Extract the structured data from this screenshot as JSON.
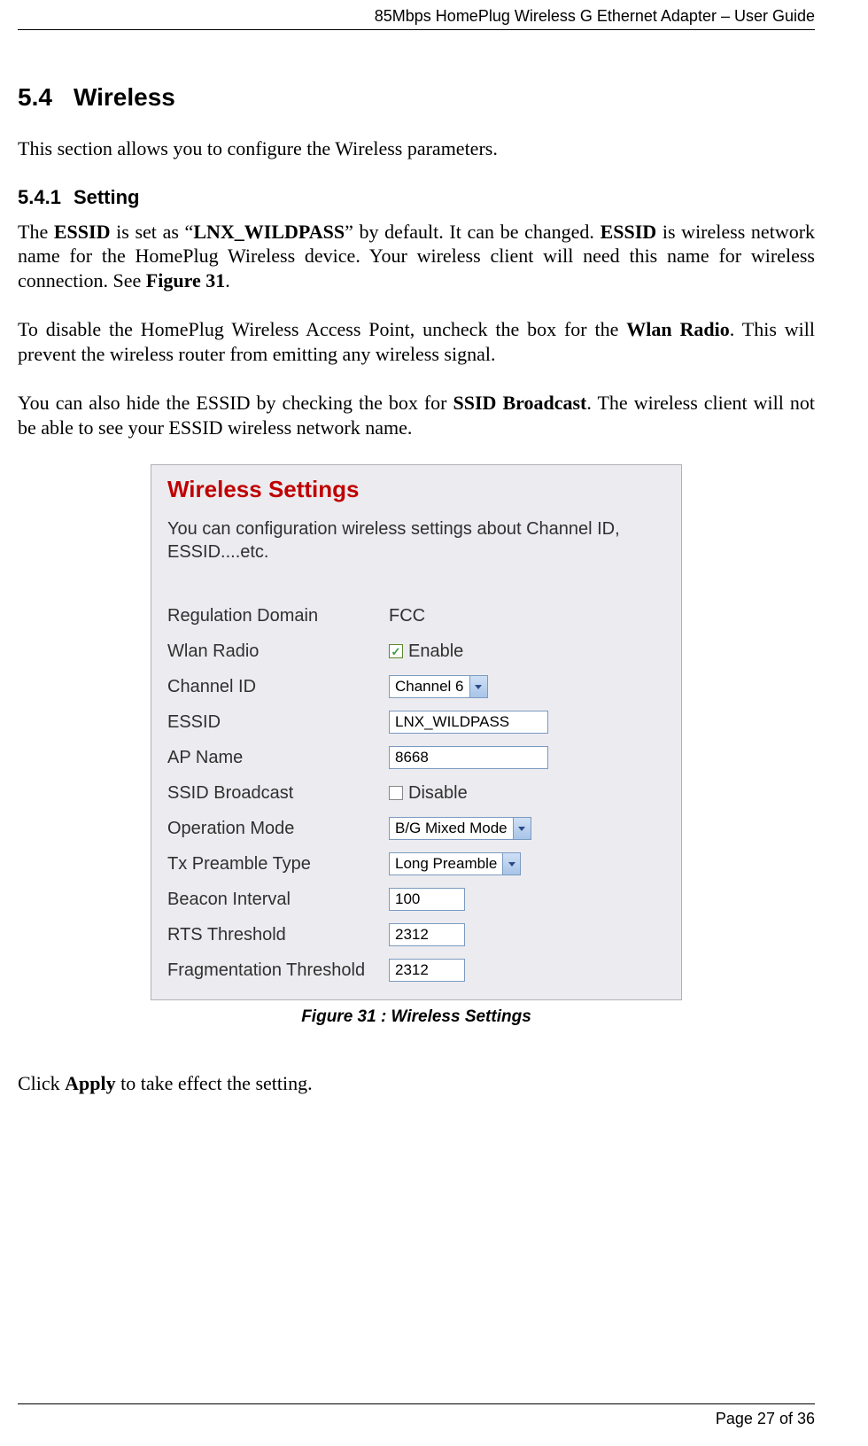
{
  "header": {
    "title": "85Mbps HomePlug Wireless G Ethernet Adapter – User Guide"
  },
  "section": {
    "number": "5.4",
    "title": "Wireless",
    "intro": "This section allows you to configure the Wireless parameters.",
    "sub": {
      "number": "5.4.1",
      "title": "Setting"
    },
    "p1_a": "The ",
    "p1_b": "ESSID",
    "p1_c": " is set as “",
    "p1_d": "LNX_WILDPASS",
    "p1_e": "” by default. It can be changed. ",
    "p1_f": "ESSID",
    "p1_g": " is wireless network name for the HomePlug Wireless device. Your wireless client will need this name for wireless connection. See ",
    "p1_h": "Figure 31",
    "p1_i": ".",
    "p2_a": "To disable the HomePlug Wireless Access Point, uncheck the box for the ",
    "p2_b": "Wlan Radio",
    "p2_c": ". This will prevent the wireless router from emitting any wireless signal.",
    "p3_a": "You can also hide the ESSID by checking the box for ",
    "p3_b": "SSID Broadcast",
    "p3_c": ". The wireless client will not be able to see your ESSID wireless network name.",
    "caption": "Figure 31 : Wireless Settings",
    "apply_a": "Click ",
    "apply_b": "Apply",
    "apply_c": " to take effect the setting."
  },
  "panel": {
    "title": "Wireless Settings",
    "desc": "You can configuration wireless settings about Channel ID, ESSID....etc.",
    "rows": {
      "reg_label": "Regulation Domain",
      "reg_value": "FCC",
      "wlan_label": "Wlan Radio",
      "wlan_text": "Enable",
      "chan_label": "Channel ID",
      "chan_value": "Channel 6",
      "essid_label": "ESSID",
      "essid_value": "LNX_WILDPASS",
      "ap_label": "AP Name",
      "ap_value": "8668",
      "ssidb_label": "SSID Broadcast",
      "ssidb_text": "Disable",
      "op_label": "Operation Mode",
      "op_value": "B/G Mixed Mode",
      "tx_label": "Tx Preamble Type",
      "tx_value": "Long Preamble",
      "beacon_label": "Beacon Interval",
      "beacon_value": "100",
      "rts_label": "RTS Threshold",
      "rts_value": "2312",
      "frag_label": "Fragmentation Threshold",
      "frag_value": "2312"
    }
  },
  "footer": {
    "page": "Page 27 of 36"
  }
}
